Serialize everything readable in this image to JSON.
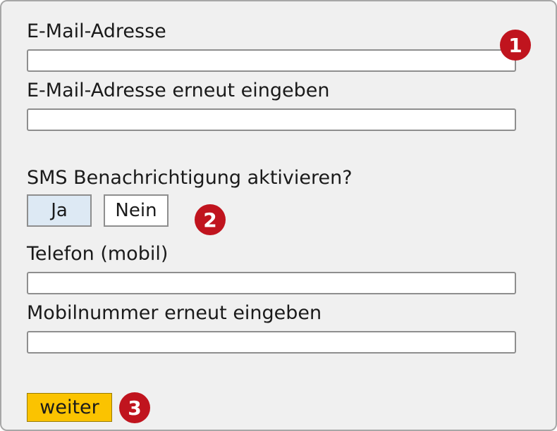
{
  "form": {
    "email": {
      "label": "E-Mail-Adresse",
      "value": "",
      "placeholder": ""
    },
    "email_confirm": {
      "label": "E-Mail-Adresse erneut eingeben",
      "value": "",
      "placeholder": ""
    },
    "sms": {
      "question": "SMS Benachrichtigung aktivieren?",
      "yes_label": "Ja",
      "no_label": "Nein",
      "selected": "Ja"
    },
    "phone": {
      "label": "Telefon (mobil)",
      "value": "",
      "placeholder": ""
    },
    "phone_confirm": {
      "label": "Mobilnummer erneut eingeben",
      "value": "",
      "placeholder": ""
    },
    "next_label": "weiter"
  },
  "markers": [
    "1",
    "2",
    "3"
  ],
  "colors": {
    "panel_background": "#f0f0f0",
    "selected_toggle": "#dde9f4",
    "next_button": "#fbc300",
    "marker": "#c0141e"
  }
}
